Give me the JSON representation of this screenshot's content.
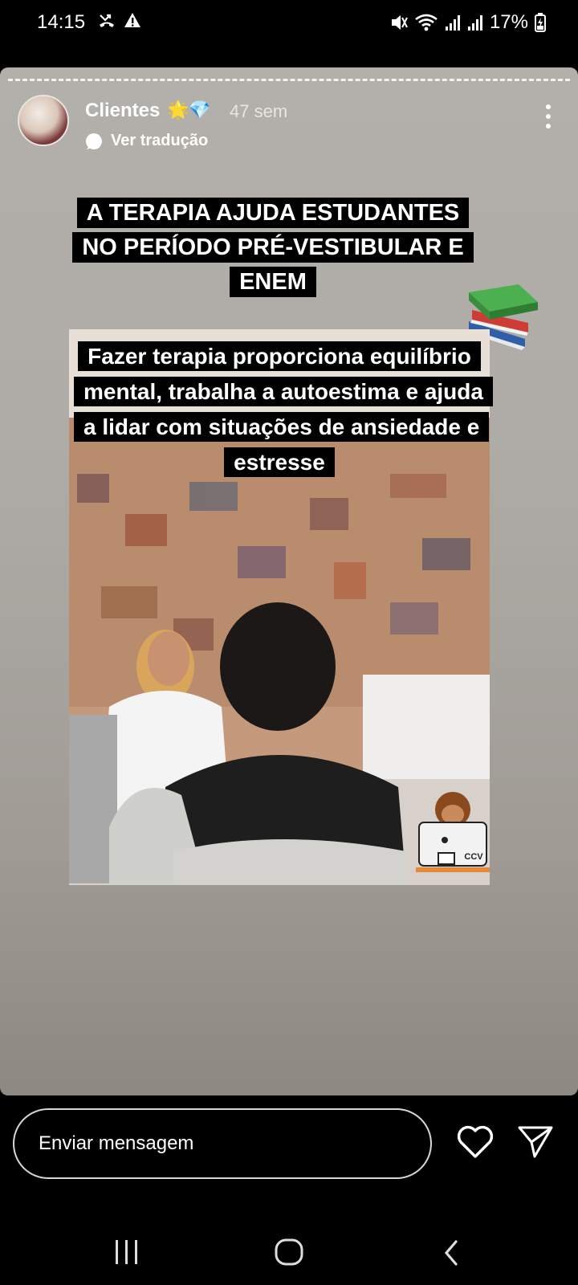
{
  "status_bar": {
    "time": "14:15",
    "battery_percent": "17%",
    "icons": [
      "missed-call-icon",
      "warning-icon",
      "mute-icon",
      "wifi-icon",
      "signal-icon",
      "signal-icon",
      "battery-charging-icon"
    ]
  },
  "story": {
    "username": "Clientes",
    "user_emojis": "🌟💎",
    "time_ago": "47 sem",
    "translate_label": "Ver tradução",
    "heading": "A TERAPIA AJUDA ESTUDANTES NO PERÍODO PRÉ-VESTIBULAR E ENEM",
    "heading_emoji": "books-icon",
    "photo_caption": "Fazer terapia proporciona equilíbrio mental, trabalha a autoestima e ajuda a lidar com situações de ansiedade e estresse",
    "photo_logo_text": "CCV"
  },
  "reply": {
    "placeholder": "Enviar mensagem"
  },
  "colors": {
    "background": "#000000",
    "story_bg": "#aeaba6",
    "text": "#ffffff"
  }
}
